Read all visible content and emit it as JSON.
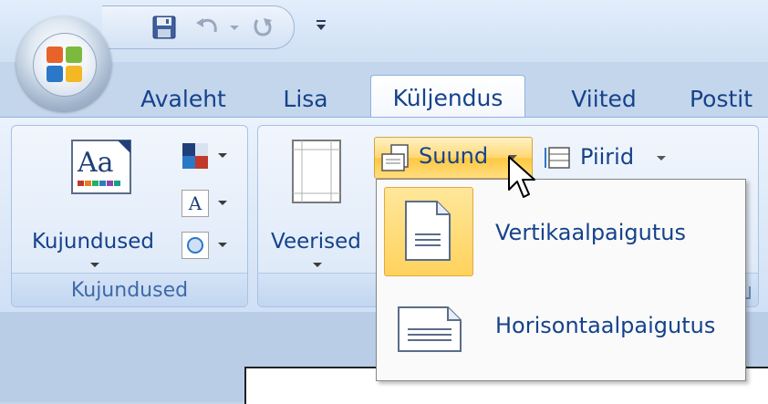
{
  "qat": {
    "save_icon": "save-icon",
    "undo_icon": "undo-icon",
    "redo_icon": "redo-icon",
    "customize_icon": "customize-qat-icon"
  },
  "tabs": [
    {
      "label": "Avaleht",
      "active": false
    },
    {
      "label": "Lisa",
      "active": false
    },
    {
      "label": "Küljendus",
      "active": true
    },
    {
      "label": "Viited",
      "active": false
    },
    {
      "label": "Postit",
      "active": false
    }
  ],
  "ribbon": {
    "themes_group": {
      "themes_button_label": "Kujundused",
      "group_label": "Kujundused"
    },
    "page_setup_group": {
      "columns_label": "Veerised",
      "orientation_label": "Suund",
      "margins_label": "Piirid"
    }
  },
  "orientation_menu": {
    "items": [
      {
        "label": "Vertikaalpaigutus",
        "selected": true
      },
      {
        "label": "Horisontaalpaigutus",
        "selected": false
      }
    ]
  },
  "colors": {
    "accent": "#15428b",
    "highlight": "#ffd25d"
  }
}
